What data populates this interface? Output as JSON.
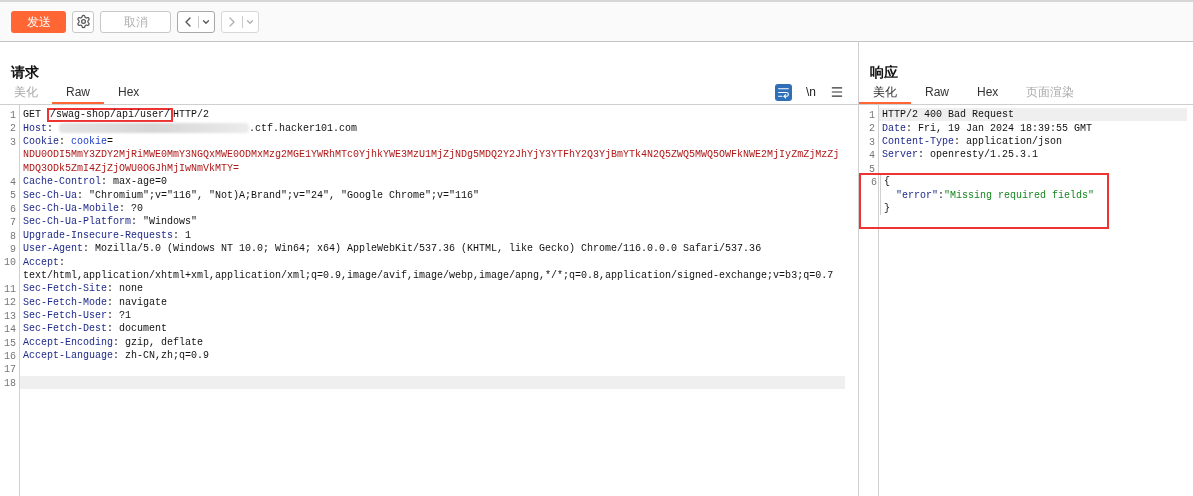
{
  "toolbar": [
    {
      "kind": "send",
      "label": "发送",
      "disabled": false
    },
    {
      "kind": "settings",
      "disabled": false
    },
    {
      "kind": "cancel",
      "label": "取消",
      "disabled": true
    },
    {
      "kind": "back",
      "disabled": false
    },
    {
      "kind": "forward",
      "disabled": true
    }
  ],
  "request": {
    "title": "请求",
    "tabs": [
      {
        "label": "美化",
        "selected": false,
        "disabled": true
      },
      {
        "label": "Raw",
        "selected": true,
        "disabled": false
      },
      {
        "label": "Hex",
        "selected": false,
        "disabled": false
      }
    ],
    "tools": [
      {
        "kind": "wrap",
        "on": true
      },
      {
        "kind": "text",
        "label": "\\n"
      },
      {
        "kind": "menu"
      }
    ],
    "lines": [
      {
        "number": "1",
        "current": false,
        "segments": [
          {
            "kind": "plain",
            "text": "GET "
          },
          {
            "kind": "plain",
            "text": "/swag-shop/api/user/",
            "boxed": true
          },
          {
            "kind": "plain",
            "text": "HTTP/2"
          }
        ]
      },
      {
        "number": "2",
        "current": false,
        "segments": [
          {
            "kind": "key",
            "text": "Host"
          },
          {
            "kind": "plain",
            "text": ": "
          },
          {
            "kind": "redacted"
          },
          {
            "kind": "plain",
            "text": ".ctf.hacker101.com"
          }
        ]
      },
      {
        "number": "3",
        "current": false,
        "segments": [
          {
            "kind": "key",
            "text": "Cookie"
          },
          {
            "kind": "plain",
            "text": ": "
          },
          {
            "kind": "cookie-name",
            "text": "cookie"
          },
          {
            "kind": "plain",
            "text": "="
          }
        ]
      },
      {
        "current": false,
        "segments": [
          {
            "kind": "cookie-value",
            "text": "NDU0ODI5MmY3ZDY2MjRiMWE0MmY3NGQxMWE0ODMxMzg2MGE1YWRhMTc0YjhkYWE3MzU1MjZjNDg5MDQ2Y2JhYjY3YTFhY2Q3YjBmYTk4N2Q5ZWQ5MWQ5OWFkNWE2MjIyZmZjMzZj"
          }
        ]
      },
      {
        "current": false,
        "segments": [
          {
            "kind": "cookie-value",
            "text": "MDQ3ODk5ZmI4ZjZjOWU0OGJhMjIwNmVkMTY="
          }
        ]
      },
      {
        "number": "4",
        "current": false,
        "segments": [
          {
            "kind": "key",
            "text": "Cache-Control"
          },
          {
            "kind": "plain",
            "text": ": max-age=0"
          }
        ]
      },
      {
        "number": "5",
        "current": false,
        "segments": [
          {
            "kind": "key",
            "text": "Sec-Ch-Ua"
          },
          {
            "kind": "plain",
            "text": ": \"Chromium\";v=\"116\", \"Not)A;Brand\";v=\"24\", \"Google Chrome\";v=\"116\""
          }
        ]
      },
      {
        "number": "6",
        "current": false,
        "segments": [
          {
            "kind": "key",
            "text": "Sec-Ch-Ua-Mobile"
          },
          {
            "kind": "plain",
            "text": ": ?0"
          }
        ]
      },
      {
        "number": "7",
        "current": false,
        "segments": [
          {
            "kind": "key",
            "text": "Sec-Ch-Ua-Platform"
          },
          {
            "kind": "plain",
            "text": ": \"Windows\""
          }
        ]
      },
      {
        "number": "8",
        "current": false,
        "segments": [
          {
            "kind": "key",
            "text": "Upgrade-Insecure-Requests"
          },
          {
            "kind": "plain",
            "text": ": 1"
          }
        ]
      },
      {
        "number": "9",
        "current": false,
        "segments": [
          {
            "kind": "key",
            "text": "User-Agent"
          },
          {
            "kind": "plain",
            "text": ": Mozilla/5.0 (Windows NT 10.0; Win64; x64) AppleWebKit/537.36 (KHTML, like Gecko) Chrome/116.0.0.0 Safari/537.36"
          }
        ]
      },
      {
        "number": "10",
        "current": false,
        "segments": [
          {
            "kind": "key",
            "text": "Accept"
          },
          {
            "kind": "plain",
            "text": ":"
          }
        ]
      },
      {
        "current": false,
        "segments": [
          {
            "kind": "plain",
            "text": "text/html,application/xhtml+xml,application/xml;q=0.9,image/avif,image/webp,image/apng,*/*;q=0.8,application/signed-exchange;v=b3;q=0.7"
          }
        ]
      },
      {
        "number": "11",
        "current": false,
        "segments": [
          {
            "kind": "key",
            "text": "Sec-Fetch-Site"
          },
          {
            "kind": "plain",
            "text": ": none"
          }
        ]
      },
      {
        "number": "12",
        "current": false,
        "segments": [
          {
            "kind": "key",
            "text": "Sec-Fetch-Mode"
          },
          {
            "kind": "plain",
            "text": ": navigate"
          }
        ]
      },
      {
        "number": "13",
        "current": false,
        "segments": [
          {
            "kind": "key",
            "text": "Sec-Fetch-User"
          },
          {
            "kind": "plain",
            "text": ": ?1"
          }
        ]
      },
      {
        "number": "14",
        "current": false,
        "segments": [
          {
            "kind": "key",
            "text": "Sec-Fetch-Dest"
          },
          {
            "kind": "plain",
            "text": ": document"
          }
        ]
      },
      {
        "number": "15",
        "current": false,
        "segments": [
          {
            "kind": "key",
            "text": "Accept-Encoding"
          },
          {
            "kind": "plain",
            "text": ": gzip, deflate"
          }
        ]
      },
      {
        "number": "16",
        "current": false,
        "segments": [
          {
            "kind": "key",
            "text": "Accept-Language"
          },
          {
            "kind": "plain",
            "text": ": zh-CN,zh;q=0.9"
          }
        ]
      },
      {
        "number": "17",
        "current": false
      },
      {
        "number": "18",
        "current": true
      }
    ]
  },
  "response": {
    "title": "响应",
    "tabs": [
      {
        "label": "美化",
        "selected": true,
        "disabled": false
      },
      {
        "label": "Raw",
        "selected": false,
        "disabled": false
      },
      {
        "label": "Hex",
        "selected": false,
        "disabled": false
      },
      {
        "label": "页面渲染",
        "selected": false,
        "disabled": true
      }
    ],
    "lines": [
      {
        "number": "1",
        "current": true,
        "boxed": false,
        "segments": [
          {
            "kind": "plain",
            "text": "HTTP/2 400 Bad Request"
          }
        ]
      },
      {
        "number": "2",
        "current": false,
        "boxed": false,
        "segments": [
          {
            "kind": "key",
            "text": "Date"
          },
          {
            "kind": "plain",
            "text": ": Fri, 19 Jan 2024 18:39:55 GMT"
          }
        ]
      },
      {
        "number": "3",
        "current": false,
        "boxed": false,
        "segments": [
          {
            "kind": "key",
            "text": "Content-Type"
          },
          {
            "kind": "plain",
            "text": ": application/json"
          }
        ]
      },
      {
        "number": "4",
        "current": false,
        "boxed": false,
        "segments": [
          {
            "kind": "key",
            "text": "Server"
          },
          {
            "kind": "plain",
            "text": ": openresty/1.25.3.1"
          }
        ]
      },
      {
        "number": "5",
        "current": false,
        "boxed": false
      },
      {
        "number": "6",
        "current": false,
        "boxed": true,
        "segments": [
          {
            "kind": "plain",
            "text": "{"
          }
        ]
      },
      {
        "current": false,
        "boxed": true,
        "segments": [
          {
            "kind": "json-key",
            "text": "  \"error\""
          },
          {
            "kind": "plain",
            "text": ":"
          },
          {
            "kind": "json-string",
            "text": "\"Missing required fields\""
          }
        ]
      },
      {
        "current": false,
        "boxed": true,
        "segments": [
          {
            "kind": "plain",
            "text": "}"
          }
        ]
      }
    ]
  }
}
